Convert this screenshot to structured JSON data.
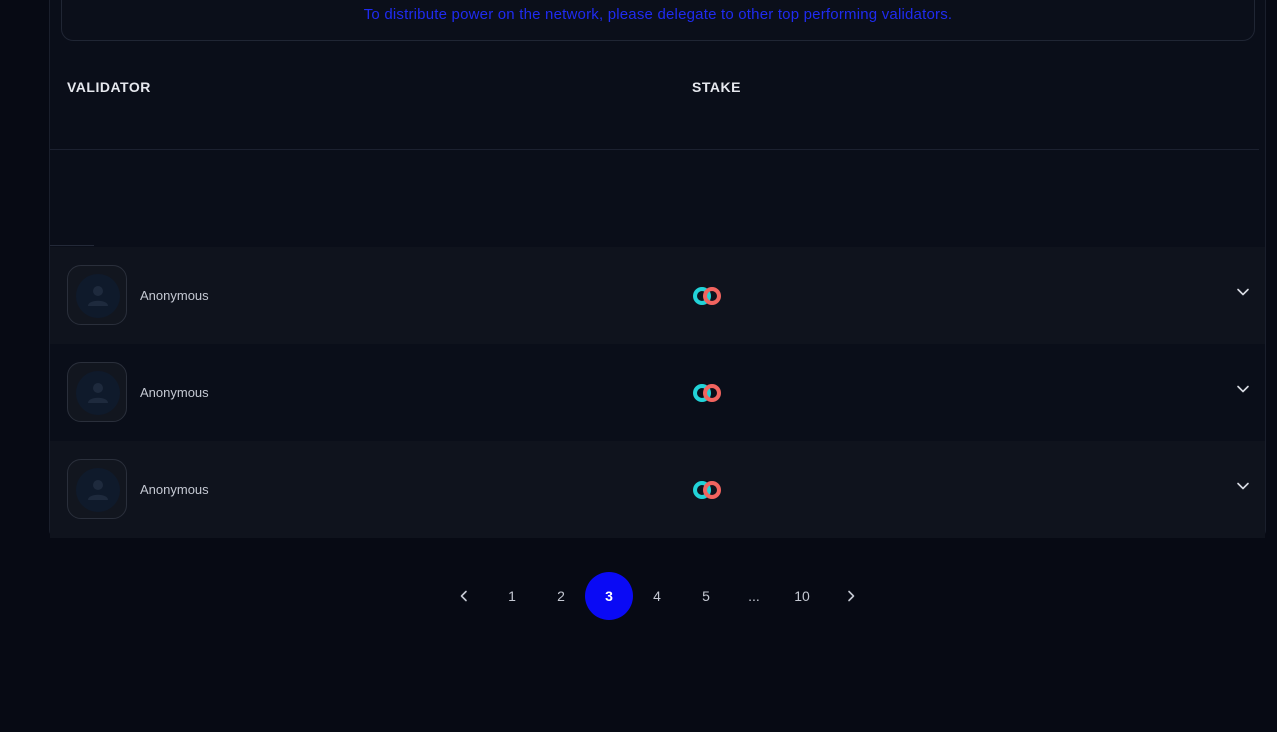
{
  "notice": {
    "text": "To distribute power on the network, please delegate to other top performing validators."
  },
  "table": {
    "columns": {
      "validator": "VALIDATOR",
      "stake": "STAKE"
    },
    "rows": [
      {
        "name": "Anonymous",
        "avatar_icon": "user-icon",
        "token_icon": "token-logo-icon"
      },
      {
        "name": "Anonymous",
        "avatar_icon": "user-icon",
        "token_icon": "token-logo-icon"
      },
      {
        "name": "Anonymous",
        "avatar_icon": "user-icon",
        "token_icon": "token-logo-icon"
      }
    ]
  },
  "pagination": {
    "prev_icon": "chevron-left-icon",
    "next_icon": "chevron-right-icon",
    "pages": [
      "1",
      "2",
      "3",
      "4",
      "5",
      "...",
      "10"
    ],
    "current": "3"
  },
  "colors": {
    "background": "#070a14",
    "notice_text": "#1f2bf0",
    "active_page": "#0a0af5",
    "token_cyan": "#22d3d8",
    "token_coral": "#f2645f"
  }
}
